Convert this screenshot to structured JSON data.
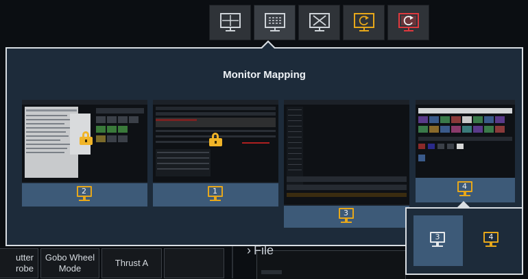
{
  "toolbar": {
    "icons": [
      "monitor-crosshair-icon",
      "monitor-mapping-icon",
      "monitor-close-icon",
      "monitor-refresh-icon",
      "monitor-reset-icon"
    ],
    "colors": {
      "default": "#cfd4d9",
      "refresh": "#e8a81a",
      "reset": "#e0393e"
    }
  },
  "panel": {
    "title": "Monitor Mapping"
  },
  "monitors": [
    {
      "number": "2",
      "locked": true
    },
    {
      "number": "1",
      "locked": true
    },
    {
      "number": "3",
      "locked": false
    },
    {
      "number": "4",
      "locked": false
    }
  ],
  "popup": {
    "options": [
      "3",
      "4"
    ],
    "selected": "3"
  },
  "bottom": {
    "btn_partial_line1": "utter",
    "btn_partial_line2": "robe",
    "gobo_line1": "Gobo Wheel",
    "gobo_line2": "Mode",
    "thrust": "Thrust A",
    "file_label": "File"
  },
  "colors": {
    "accent": "#e8a81a",
    "panel_bg": "#1d2b3a",
    "footer_bg": "#3d5a78",
    "border": "#d9dee3"
  }
}
